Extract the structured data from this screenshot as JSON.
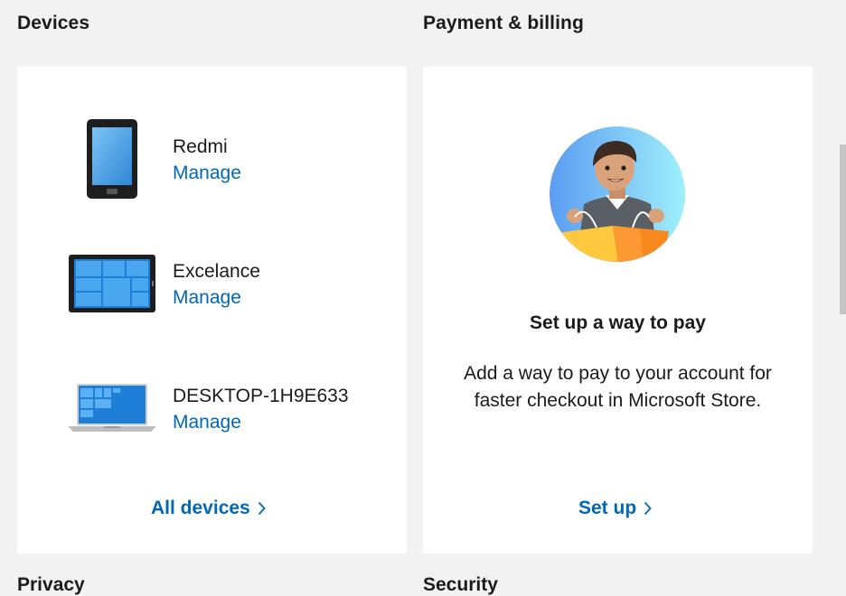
{
  "devices_section": {
    "heading": "Devices",
    "items": [
      {
        "name": "Redmi",
        "manage_label": "Manage",
        "icon": "phone-icon"
      },
      {
        "name": "Excelance",
        "manage_label": "Manage",
        "icon": "tablet-icon"
      },
      {
        "name": "DESKTOP-1H9E633",
        "manage_label": "Manage",
        "icon": "laptop-icon"
      }
    ],
    "all_devices_label": "All devices"
  },
  "payment_section": {
    "heading": "Payment & billing",
    "illustration": "shopper-illustration",
    "title": "Set up a way to pay",
    "description": "Add a way to pay to your account for faster checkout in Microsoft Store.",
    "setup_label": "Set up"
  },
  "next_sections": {
    "left_heading": "Privacy",
    "right_heading": "Security"
  },
  "colors": {
    "link": "#0067b8",
    "background": "#f2f2f2",
    "card": "#ffffff",
    "text": "#1b1b1b"
  }
}
